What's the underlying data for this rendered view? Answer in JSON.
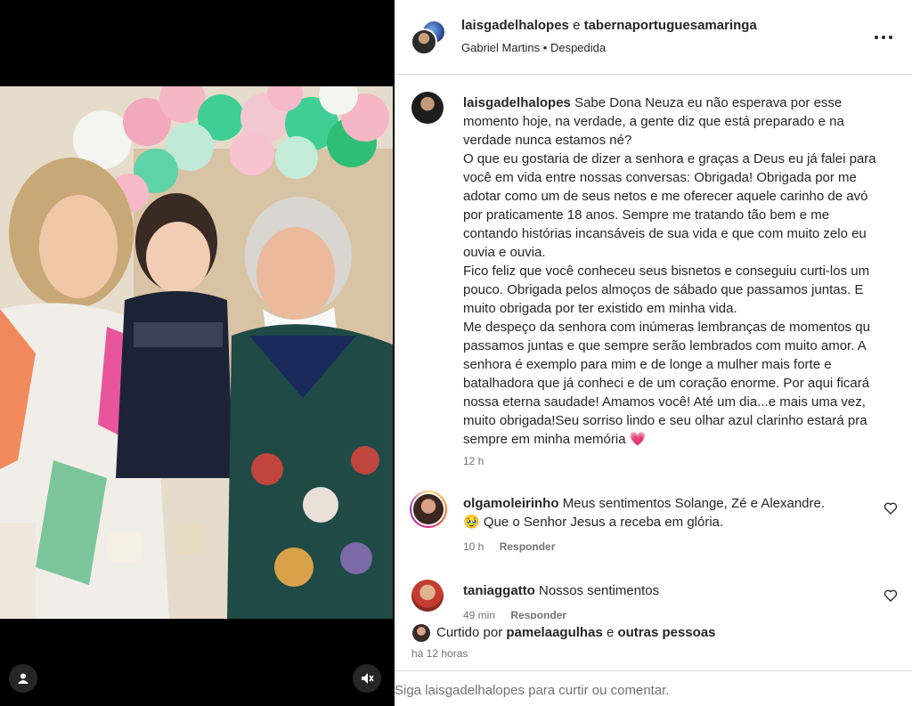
{
  "post": {
    "owners": [
      "laisgadelhalopes",
      "tabernaportuguesamaringa"
    ],
    "owners_conjunction": "e",
    "subline_author": "Gabriel Martins",
    "subline_separator": "•",
    "subline_title": "Despedida"
  },
  "caption": {
    "username": "laisgadelhalopes",
    "paragraphs": [
      "Sabe Dona Neuza eu não esperava por esse momento hoje, na verdade, a gente diz que está preparado e na verdade nunca estamos né?",
      "O que eu gostaria de dizer a senhora e graças a Deus eu já falei para você em vida entre nossas conversas: Obrigada! Obrigada por me adotar como um de seus netos e me oferecer aquele carinho de avó por praticamente 18 anos. Sempre me tratando tão bem e me contando histórias incansáveis de sua vida e que com muito zelo eu ouvia e ouvia.",
      "Fico feliz que você conheceu seus bisnetos e conseguiu curti-los um pouco. Obrigada pelos almoços de sábado que passamos juntas. E muito obrigada por ter existido em minha vida.",
      "Me despeço da senhora com inúmeras lembranças de momentos qu passamos juntas e que sempre serão lembrados com muito amor. A senhora é exemplo para mim e de longe a mulher mais forte e batalhadora que já conheci e de um coração enorme. Por aqui ficará nossa eterna saudade! Amamos você! Até um dia...e mais uma vez, muito obrigada!Seu sorriso lindo e seu olhar azul clarinho estará pra sempre em minha memória"
    ],
    "emoji": "💗",
    "time": "12 h"
  },
  "comments": [
    {
      "username": "olgamoleirinho",
      "text_line1": "Meus sentimentos Solange, Zé e Alexandre.",
      "emoji": "🥹",
      "text_line2": "Que o Senhor Jesus a receba em glória.",
      "time": "10 h",
      "reply_label": "Responder"
    },
    {
      "username": "taniaggatto",
      "text_line1": "Nossos sentimentos",
      "time": "49 min",
      "reply_label": "Responder"
    }
  ],
  "likes": {
    "prefix": "Curtido por",
    "liker": "pamelaagulhas",
    "conjunction": "e",
    "others": "outras pessoas"
  },
  "post_time": "há 12 horas",
  "login_prompt": "Siga laisgadelhalopes para curtir ou comentar.",
  "colors": {
    "text": "#262626",
    "secondary": "#737373",
    "divider": "#dbdbdb",
    "heart": "#ed2a7b"
  },
  "icons": [
    "user-tag-icon",
    "mute-icon",
    "more-options-icon",
    "heart-outline-icon"
  ]
}
